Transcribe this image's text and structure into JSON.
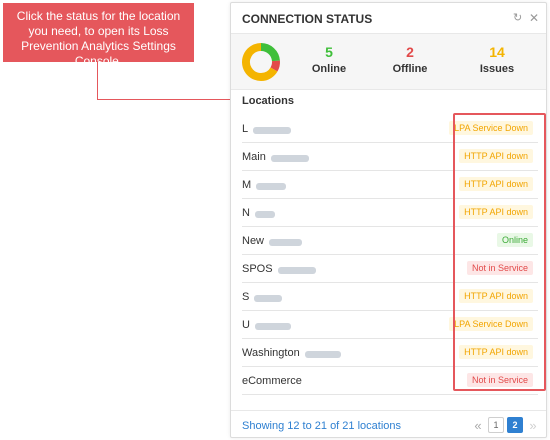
{
  "callout": {
    "text": "Click the status for the location you need, to open its Loss Prevention Analytics Settings Console."
  },
  "panel": {
    "title": "CONNECTION STATUS",
    "icons": [
      "refresh-icon",
      "close-icon"
    ]
  },
  "summary": {
    "donut": {
      "segments": [
        {
          "label": "Online",
          "value": 5,
          "color": "#3fbf3a"
        },
        {
          "label": "Offline",
          "value": 2,
          "color": "#e24a4a"
        },
        {
          "label": "Issues",
          "value": 14,
          "color": "#f4b400"
        }
      ]
    },
    "online": {
      "value": "5",
      "label": "Online",
      "color": "#3fbf3a"
    },
    "offline": {
      "value": "2",
      "label": "Offline",
      "color": "#e24a4a"
    },
    "issues": {
      "value": "14",
      "label": "Issues",
      "color": "#f4b400"
    }
  },
  "locations_heading": "Locations",
  "locations": [
    {
      "name": "L",
      "status": "LPA Service Down",
      "type": "orange"
    },
    {
      "name": "Main",
      "status": "HTTP API down",
      "type": "orange"
    },
    {
      "name": "M",
      "status": "HTTP API down",
      "type": "orange"
    },
    {
      "name": "N",
      "status": "HTTP API down",
      "type": "orange"
    },
    {
      "name": "New",
      "status": "Online",
      "type": "green"
    },
    {
      "name": "SPOS",
      "status": "Not in Service",
      "type": "red"
    },
    {
      "name": "S",
      "status": "HTTP API down",
      "type": "orange"
    },
    {
      "name": "U",
      "status": "LPA Service Down",
      "type": "orange"
    },
    {
      "name": "Washington",
      "status": "HTTP API down",
      "type": "orange"
    },
    {
      "name": "eCommerce",
      "status": "Not in Service",
      "type": "red"
    }
  ],
  "footer": {
    "showing": "Showing 12 to 21 of 21 locations",
    "pages": [
      "1",
      "2"
    ],
    "current_page": "2",
    "prev_icon": "double-chevron-left-icon",
    "next_icon": "double-chevron-right-icon"
  }
}
